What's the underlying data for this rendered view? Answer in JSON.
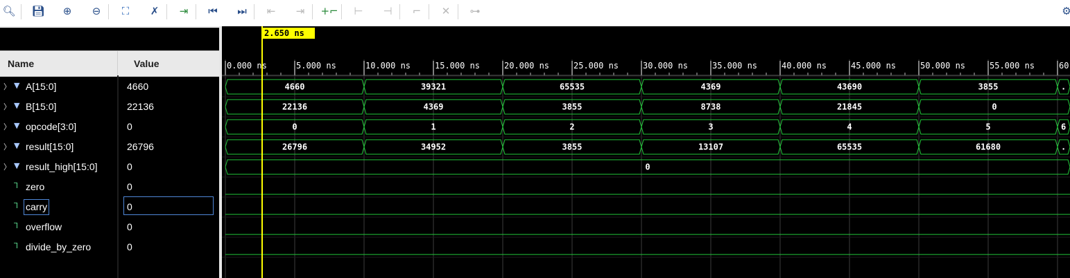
{
  "toolbar": {
    "buttons": [
      {
        "name": "search-icon",
        "glyph": "🔍︎",
        "enabled": true
      },
      {
        "name": "save-icon",
        "glyph": "💾︎",
        "enabled": true
      },
      {
        "name": "zoom-in-icon",
        "glyph": "⊕",
        "enabled": true
      },
      {
        "name": "zoom-out-icon",
        "glyph": "⊖",
        "enabled": true
      },
      {
        "name": "zoom-fit-icon",
        "glyph": "⛶",
        "enabled": true
      },
      {
        "name": "snap-to-transition-icon",
        "glyph": "✗",
        "enabled": true
      },
      {
        "name": "go-to-cursor-icon",
        "glyph": "⇥",
        "enabled": true
      },
      {
        "name": "go-to-time-zero-icon",
        "glyph": "⏮︎",
        "enabled": true
      },
      {
        "name": "go-to-last-time-icon",
        "glyph": "⏭︎",
        "enabled": true
      },
      {
        "name": "previous-transition-icon",
        "glyph": "⇤",
        "enabled": false
      },
      {
        "name": "next-transition-icon",
        "glyph": "⇥",
        "enabled": false
      },
      {
        "name": "add-marker-icon",
        "glyph": "+⌐",
        "enabled": true
      },
      {
        "name": "previous-marker-icon",
        "glyph": "⊢",
        "enabled": false
      },
      {
        "name": "next-marker-icon",
        "glyph": "⊣",
        "enabled": false
      },
      {
        "name": "swap-cursors-icon",
        "glyph": "⌐",
        "enabled": false
      },
      {
        "name": "delete-marker-icon",
        "glyph": "✕",
        "enabled": false
      },
      {
        "name": "fix-cursor-icon",
        "glyph": "⊶",
        "enabled": false
      }
    ],
    "settings_icon": "⚙"
  },
  "columns": {
    "name": "Name",
    "value": "Value"
  },
  "signals": [
    {
      "name": "A[15:0]",
      "value": "4660",
      "kind": "bus",
      "expandable": true
    },
    {
      "name": "B[15:0]",
      "value": "22136",
      "kind": "bus",
      "expandable": true
    },
    {
      "name": "opcode[3:0]",
      "value": "0",
      "kind": "bus",
      "expandable": true
    },
    {
      "name": "result[15:0]",
      "value": "26796",
      "kind": "bus",
      "expandable": true
    },
    {
      "name": "result_high[15:0]",
      "value": "0",
      "kind": "bus",
      "expandable": true
    },
    {
      "name": "zero",
      "value": "0",
      "kind": "bit",
      "expandable": false
    },
    {
      "name": "carry",
      "value": "0",
      "kind": "bit",
      "expandable": false,
      "selected": true
    },
    {
      "name": "overflow",
      "value": "0",
      "kind": "bit",
      "expandable": false
    },
    {
      "name": "divide_by_zero",
      "value": "0",
      "kind": "bit",
      "expandable": false
    }
  ],
  "cursor": {
    "time_ns": 2.65,
    "label": "2.650 ns"
  },
  "timeline": {
    "tick_labels": [
      "0.000 ns",
      "5.000 ns",
      "10.000 ns",
      "15.000 ns",
      "20.000 ns",
      "25.000 ns",
      "30.000 ns",
      "35.000 ns",
      "40.000 ns",
      "45.000 ns",
      "50.000 ns",
      "55.000 ns",
      "60"
    ],
    "tick_times_ns": [
      0,
      5,
      10,
      15,
      20,
      25,
      30,
      35,
      40,
      45,
      50,
      55,
      60
    ]
  },
  "waveforms": [
    {
      "signal": "A[15:0]",
      "segments": [
        {
          "start": 0,
          "end": 10,
          "value": "4660"
        },
        {
          "start": 10,
          "end": 20,
          "value": "39321"
        },
        {
          "start": 20,
          "end": 30,
          "value": "65535"
        },
        {
          "start": 30,
          "end": 40,
          "value": "4369"
        },
        {
          "start": 40,
          "end": 50,
          "value": "43690"
        },
        {
          "start": 50,
          "end": 60,
          "value": "3855"
        },
        {
          "start": 60,
          "end": 61.2,
          "value": "."
        }
      ]
    },
    {
      "signal": "B[15:0]",
      "segments": [
        {
          "start": 0,
          "end": 10,
          "value": "22136"
        },
        {
          "start": 10,
          "end": 20,
          "value": "4369"
        },
        {
          "start": 20,
          "end": 30,
          "value": "3855"
        },
        {
          "start": 30,
          "end": 40,
          "value": "8738"
        },
        {
          "start": 40,
          "end": 50,
          "value": "21845"
        },
        {
          "start": 50,
          "end": 61.2,
          "value": "0"
        }
      ]
    },
    {
      "signal": "opcode[3:0]",
      "segments": [
        {
          "start": 0,
          "end": 10,
          "value": "0"
        },
        {
          "start": 10,
          "end": 20,
          "value": "1"
        },
        {
          "start": 20,
          "end": 30,
          "value": "2"
        },
        {
          "start": 30,
          "end": 40,
          "value": "3"
        },
        {
          "start": 40,
          "end": 50,
          "value": "4"
        },
        {
          "start": 50,
          "end": 60,
          "value": "5"
        },
        {
          "start": 60,
          "end": 61.2,
          "value": "6"
        }
      ]
    },
    {
      "signal": "result[15:0]",
      "segments": [
        {
          "start": 0,
          "end": 10,
          "value": "26796"
        },
        {
          "start": 10,
          "end": 20,
          "value": "34952"
        },
        {
          "start": 20,
          "end": 30,
          "value": "3855"
        },
        {
          "start": 30,
          "end": 40,
          "value": "13107"
        },
        {
          "start": 40,
          "end": 50,
          "value": "65535"
        },
        {
          "start": 50,
          "end": 60,
          "value": "61680"
        },
        {
          "start": 60,
          "end": 61.2,
          "value": "."
        }
      ]
    },
    {
      "signal": "result_high[15:0]",
      "segments": [
        {
          "start": 0,
          "end": 61.2,
          "value": "0"
        }
      ]
    },
    {
      "signal": "zero",
      "level": 0
    },
    {
      "signal": "carry",
      "level": 0
    },
    {
      "signal": "overflow",
      "level": 0
    },
    {
      "signal": "divide_by_zero",
      "level": 0
    }
  ],
  "colors": {
    "wave": "#22c83a",
    "cursor": "#ffff00",
    "background": "#000000",
    "grid": "#4a4a4a"
  }
}
